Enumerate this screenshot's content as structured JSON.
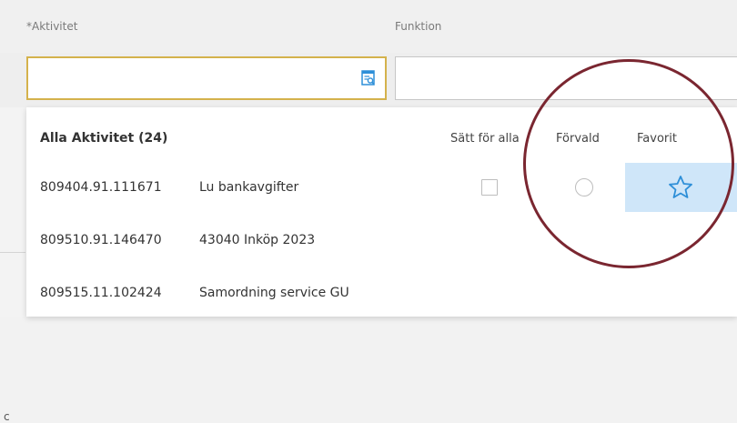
{
  "form": {
    "aktivitet_label": "*Aktivitet",
    "funktion_label": "Funktion",
    "aktivitet_value": "",
    "funktion_value": ""
  },
  "dropdown": {
    "title": "Alla Aktivitet (24)",
    "columns": {
      "set_for_all": "Sätt för alla",
      "default": "Förvald",
      "favorite": "Favorit"
    },
    "rows": [
      {
        "code": "809404.91.111671",
        "description": "Lu bankavgifter"
      },
      {
        "code": "809510.91.146470",
        "description": "43040 Inköp 2023"
      },
      {
        "code": "809515.11.102424",
        "description": "Samordning service GU"
      }
    ]
  },
  "left_pane": {
    "cut_off_text": "c"
  },
  "colors": {
    "focus_border": "#d4b24c",
    "favorite_highlight": "#cfe6f9",
    "star_icon": "#2e8fd8",
    "annotation_circle": "#7a2630"
  },
  "icons": {
    "search": "search-list-icon",
    "favorite": "star-outline-icon"
  }
}
